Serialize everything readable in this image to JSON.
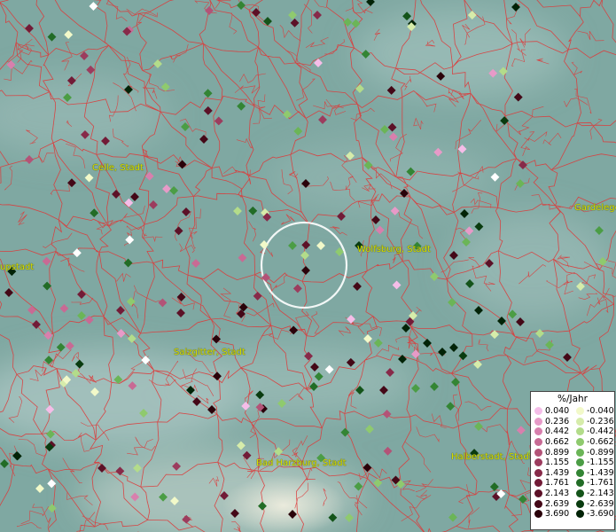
{
  "colors": {
    "background": "#7fa8a2",
    "boundary": "#dd3a3a",
    "label": "#d8e000",
    "circle": "#ffffff"
  },
  "cities": [
    {
      "name": "Celle, Stadt"
    },
    {
      "name": "Wolfsburg, Stadt"
    },
    {
      "name": "Gardelege"
    },
    {
      "name": "upstadt"
    },
    {
      "name": "Salzgitter, Stadt"
    },
    {
      "name": "Bad Harzburg, Stadt"
    },
    {
      "name": "Halberstadt, Stadt"
    }
  ],
  "legend": {
    "title": "%/Jahr",
    "positive": [
      {
        "label": "0.040",
        "color": "#f5bde8"
      },
      {
        "label": "0.236",
        "color": "#e79ac8"
      },
      {
        "label": "0.442",
        "color": "#d87fad"
      },
      {
        "label": "0.662",
        "color": "#c86a94"
      },
      {
        "label": "0.899",
        "color": "#b35377"
      },
      {
        "label": "1.155",
        "color": "#9c3c5e"
      },
      {
        "label": "1.439",
        "color": "#872a49"
      },
      {
        "label": "1.761",
        "color": "#721b37"
      },
      {
        "label": "2.143",
        "color": "#5c1127"
      },
      {
        "label": "2.639",
        "color": "#440817"
      },
      {
        "label": "3.690",
        "color": "#2a020a"
      }
    ],
    "negative": [
      {
        "label": "-0.040",
        "color": "#f2f9c9"
      },
      {
        "label": "-0.236",
        "color": "#d6ecaa"
      },
      {
        "label": "-0.442",
        "color": "#b3dc8a"
      },
      {
        "label": "-0.662",
        "color": "#8fca6e"
      },
      {
        "label": "-0.899",
        "color": "#6bb557"
      },
      {
        "label": "-1.155",
        "color": "#4b9d45"
      },
      {
        "label": "-1.439",
        "color": "#338534"
      },
      {
        "label": "-1.761",
        "color": "#226c26"
      },
      {
        "label": "-2.143",
        "color": "#14541a"
      },
      {
        "label": "-2.639",
        "color": "#093b0f"
      },
      {
        "label": "-3.690",
        "color": "#022307"
      }
    ]
  }
}
